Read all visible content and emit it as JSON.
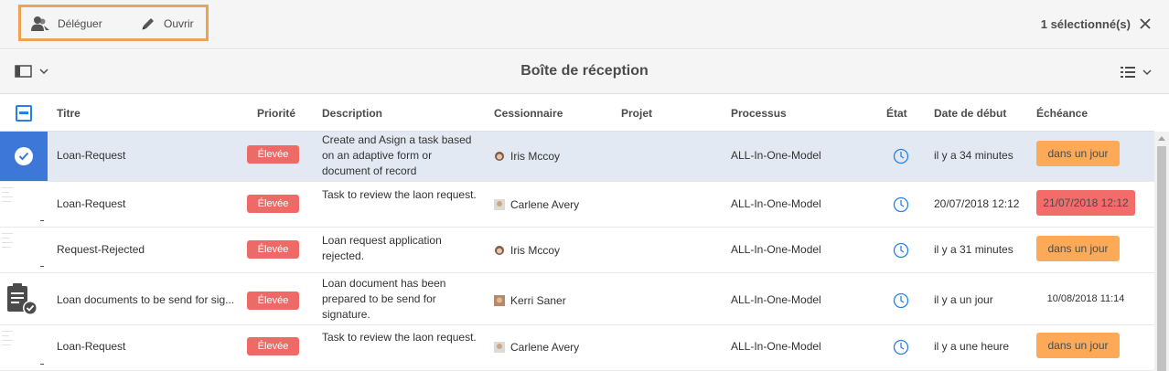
{
  "actionbar": {
    "delegate_label": "Déléguer",
    "open_label": "Ouvrir",
    "selection_count": "1 sélectionné(s)",
    "highlight_color": "#f0a253"
  },
  "titlebar": {
    "title": "Boîte de réception"
  },
  "table": {
    "columns": {
      "title": "Titre",
      "priority": "Priorité",
      "description": "Description",
      "assignee": "Cessionnaire",
      "project": "Projet",
      "process": "Processus",
      "state": "État",
      "start_date": "Date de début",
      "due": "Échéance"
    },
    "rows": [
      {
        "thumbnail": "selected-check",
        "title": "Loan-Request",
        "priority": "Élevée",
        "description": "Create and Asign a task based on an adaptive form or document of record",
        "assignee": "Iris Mccoy",
        "avatar": "avatar-female-icon",
        "project": "",
        "process": "ALL-In-One-Model",
        "state_icon": "clock-icon",
        "start_date": "il y a 34 minutes",
        "due": "dans un jour",
        "due_style": "orange"
      },
      {
        "thumbnail": "document",
        "title": "Loan-Request",
        "priority": "Élevée",
        "description": "Task to review the laon request.",
        "assignee": "Carlene Avery",
        "avatar": "avatar-female-icon",
        "project": "",
        "process": "ALL-In-One-Model",
        "state_icon": "clock-icon",
        "start_date": "20/07/2018 12:12",
        "due": "21/07/2018 12:12",
        "due_style": "red"
      },
      {
        "thumbnail": "document",
        "title": "Request-Rejected",
        "priority": "Élevée",
        "description": "Loan request application rejected.",
        "assignee": "Iris Mccoy",
        "avatar": "avatar-female-icon",
        "project": "",
        "process": "ALL-In-One-Model",
        "state_icon": "clock-icon",
        "start_date": "il y a 31 minutes",
        "due": "dans un jour",
        "due_style": "orange"
      },
      {
        "thumbnail": "clipboard",
        "title": "Loan documents to be send for sig...",
        "priority": "Élevée",
        "description": "Loan document has been prepared to be send for signature.",
        "assignee": "Kerri Saner",
        "avatar": "avatar-male-icon",
        "project": "",
        "process": "ALL-In-One-Model",
        "state_icon": "clock-icon",
        "start_date": "il y a un jour",
        "due": "10/08/2018 11:14",
        "due_style": "plain"
      },
      {
        "thumbnail": "document",
        "title": "Loan-Request",
        "priority": "Élevée",
        "description": "Task to review the laon request.",
        "assignee": "Carlene Avery",
        "avatar": "avatar-female-icon",
        "project": "",
        "process": "ALL-In-One-Model",
        "state_icon": "clock-icon",
        "start_date": "il y a une heure",
        "due": "dans un jour",
        "due_style": "orange"
      }
    ]
  },
  "colors": {
    "priority_badge": "#ef6a67",
    "due_orange": "#fcaa58",
    "due_red": "#f26c6a",
    "selection_blue": "#3d78d8",
    "selected_row_bg": "#e3e9f3",
    "clock_blue": "#2680eb"
  }
}
